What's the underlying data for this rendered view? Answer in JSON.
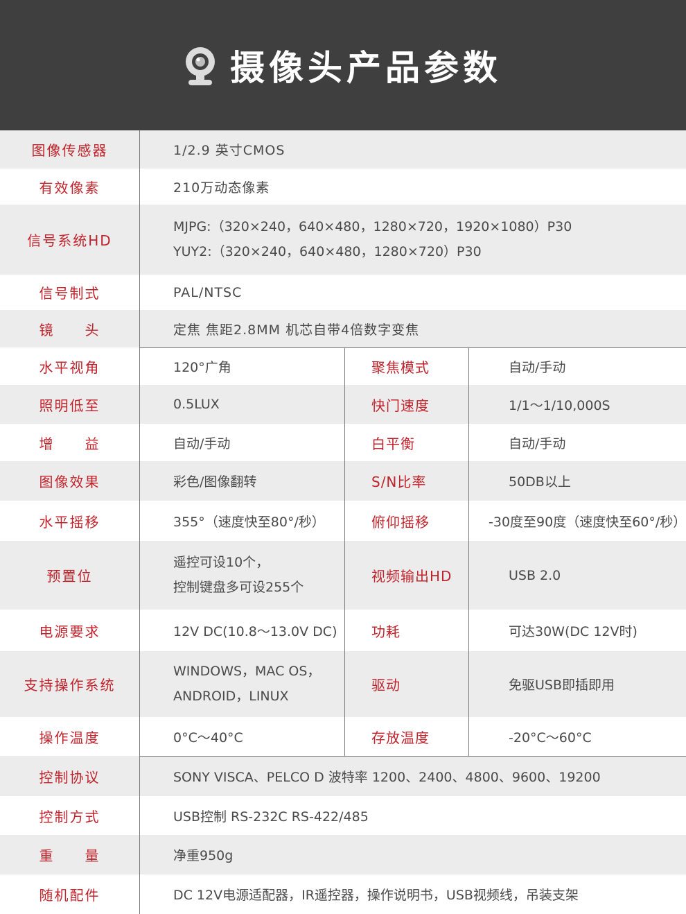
{
  "header": {
    "title": "摄像头产品参数"
  },
  "rows_full_top": [
    {
      "label": "图像传感器",
      "value": "1/2.9 英寸CMOS"
    },
    {
      "label": "有效像素",
      "value": "210万动态像素"
    },
    {
      "label": "信号系统HD",
      "lines": [
        "MJPG:（320×240，640×480，1280×720，1920×1080）P30",
        "YUY2:（320×240，640×480，1280×720）P30"
      ]
    },
    {
      "label": "信号制式",
      "value": "PAL/NTSC"
    },
    {
      "label": "镜　　头",
      "value": "定焦 焦距2.8MM  机芯自带4倍数字变焦"
    }
  ],
  "rows_split": [
    {
      "label": "水平视角",
      "value": "120°广角",
      "label2": "聚焦模式",
      "value2": "自动/手动"
    },
    {
      "label": "照明低至",
      "value": "0.5LUX",
      "label2": "快门速度",
      "value2": "1/1～1/10,000S"
    },
    {
      "label": "增　　益",
      "value": "自动/手动",
      "label2": "白平衡",
      "value2": "自动/手动"
    },
    {
      "label": "图像效果",
      "value": "彩色/图像翻转",
      "label2": "S/N比率",
      "value2": "50DB以上"
    },
    {
      "label": "水平摇移",
      "value": "355°（速度快至80°/秒）",
      "label2": "俯仰摇移",
      "value2": "-30度至90度（速度快至60°/秒）"
    },
    {
      "label": "预置位",
      "lines": [
        "遥控可设10个，",
        "控制键盘多可设255个"
      ],
      "label2": "视频输出HD",
      "value2": "USB 2.0"
    },
    {
      "label": "电源要求",
      "value": "12V DC(10.8～13.0V DC)",
      "label2": "功耗",
      "value2": "可达30W(DC 12V时)"
    },
    {
      "label": "支持操作系统",
      "lines": [
        "WINDOWS，MAC OS，",
        "ANDROID，LINUX"
      ],
      "label2": "驱动",
      "value2": "免驱USB即插即用"
    },
    {
      "label": "操作温度",
      "value": "0°C～40°C",
      "label2": "存放温度",
      "value2": "-20°C～60°C"
    }
  ],
  "rows_full_bottom": [
    {
      "label": "控制协议",
      "value": "SONY VISCA、PELCO D 波特率 1200、2400、4800、9600、19200"
    },
    {
      "label": "控制方式",
      "value": "USB控制 RS-232C  RS-422/485"
    },
    {
      "label": "重　　量",
      "value": "净重950g"
    },
    {
      "label": "随机配件",
      "value": "DC 12V电源适配器，IR遥控器，操作说明书，USB视频线，吊装支架"
    }
  ],
  "colors": {
    "banner": "#3f3f3f",
    "label": "#c0232b",
    "text": "#4a4a4a",
    "shade": "#ececec"
  }
}
